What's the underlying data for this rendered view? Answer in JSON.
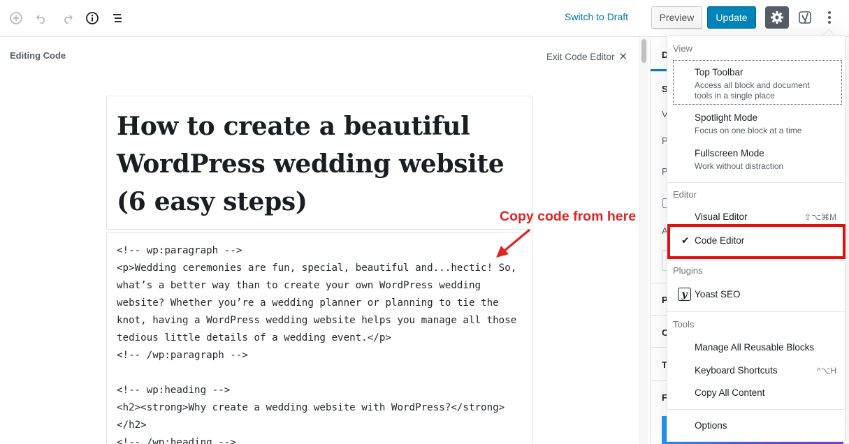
{
  "toolbar": {
    "icons": [
      "add-block-icon",
      "undo-icon",
      "redo-icon",
      "info-icon",
      "block-navigation-icon"
    ],
    "switch_to_draft": "Switch to Draft",
    "preview": "Preview",
    "update": "Update"
  },
  "editor": {
    "editing_label": "Editing Code",
    "exit_label": "Exit Code Editor",
    "exit_icon": "✕",
    "title_lines": [
      "How to create a beautiful",
      "WordPress wedding website",
      "(6 easy steps)"
    ],
    "code_lines": [
      "<!-- wp:paragraph -->",
      "<p>Wedding ceremonies are fun, special, beautiful and...hectic! So,",
      "what’s a better way than to create your own WordPress wedding",
      "website? Whether you’re a wedding planner or planning to tie the",
      "knot, having a WordPress wedding website helps you manage all those",
      "tedious little details of a wedding event.</p>",
      "<!-- /wp:paragraph -->",
      "",
      "<!-- wp:heading -->",
      "<h2><strong>Why create a wedding website with WordPress?</strong>",
      "</h2>",
      "<!-- /wp:heading -->"
    ]
  },
  "annotation": {
    "text": "Copy code from here",
    "color": "#e02424"
  },
  "sidebar": {
    "tab_letter": "D",
    "letters": [
      "S",
      "V",
      "P",
      "P",
      "A",
      "P",
      "C",
      "T",
      "F"
    ]
  },
  "menu": {
    "view": {
      "label": "View",
      "items": [
        {
          "label": "Top Toolbar",
          "desc": "Access all block and document tools in a single place"
        },
        {
          "label": "Spotlight Mode",
          "desc": "Focus on one block at a time"
        },
        {
          "label": "Fullscreen Mode",
          "desc": "Work without distraction"
        }
      ]
    },
    "editor": {
      "label": "Editor",
      "visual": "Visual Editor",
      "visual_shortcut": "⇧⌥⌘M",
      "code": "Code Editor",
      "check": "✔"
    },
    "plugins": {
      "label": "Plugins",
      "yoast": "Yoast SEO",
      "yoast_glyph": "y"
    },
    "tools": {
      "label": "Tools",
      "reusable": "Manage All Reusable Blocks",
      "shortcuts": "Keyboard Shortcuts",
      "shortcuts_key": "^⌥H",
      "copy": "Copy All Content"
    },
    "options": "Options"
  },
  "colors": {
    "accent": "#0085ba",
    "highlight": "#e01010",
    "settings_active": "#555d66"
  }
}
